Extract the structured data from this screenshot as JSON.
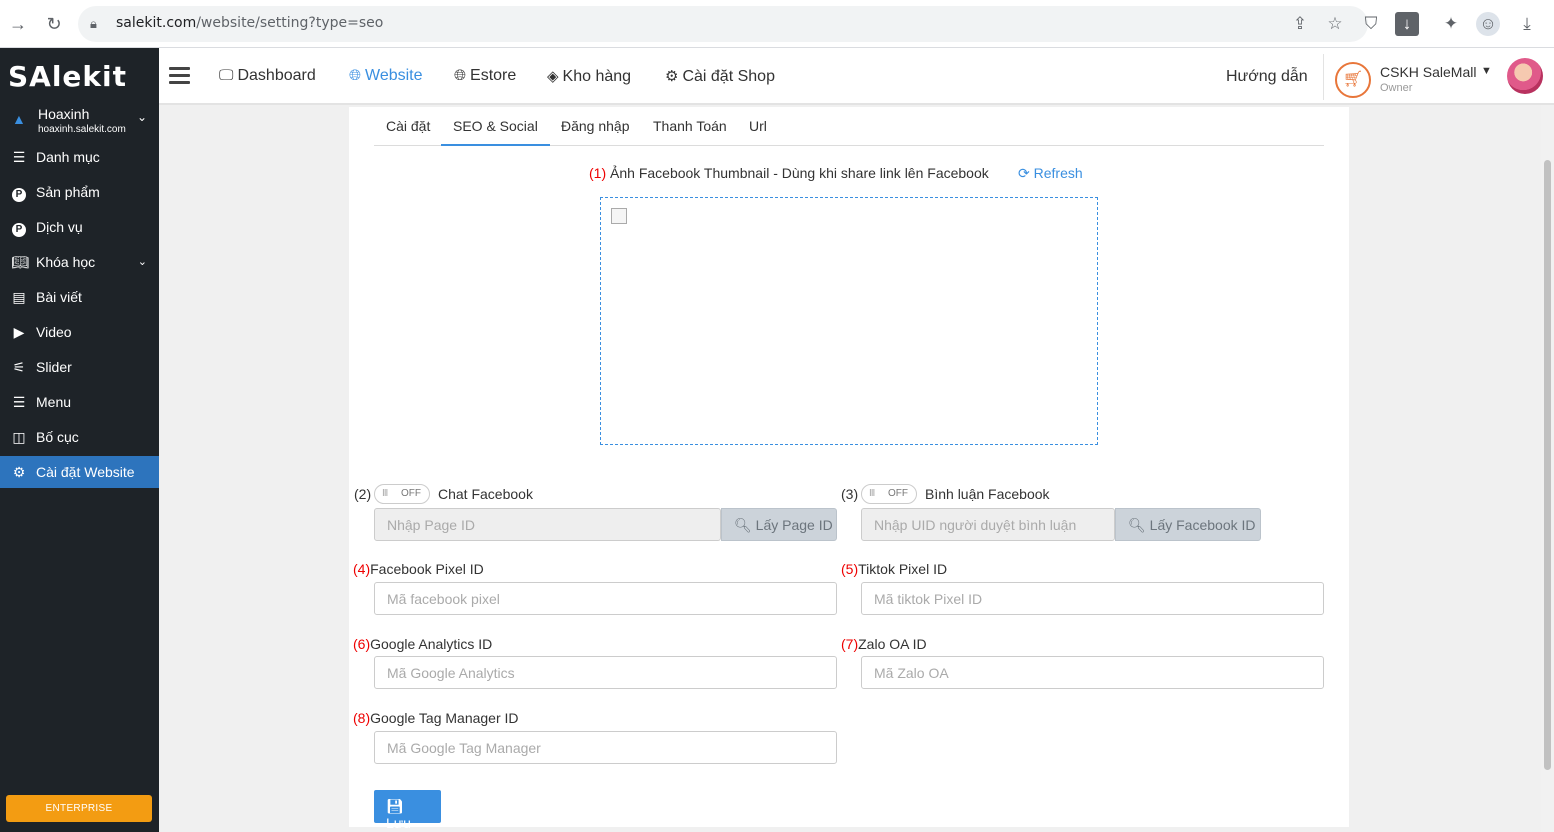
{
  "browser": {
    "url_host": "salekit.com",
    "url_path": "/website/setting?type=seo"
  },
  "sidebar": {
    "logo": "SAlekit",
    "workspace": {
      "name": "Hoaxinh",
      "domain": "hoaxinh.salekit.com"
    },
    "items": [
      {
        "label": "Danh mục"
      },
      {
        "label": "Sản phẩm"
      },
      {
        "label": "Dịch vụ"
      },
      {
        "label": "Khóa học"
      },
      {
        "label": "Bài viết"
      },
      {
        "label": "Video"
      },
      {
        "label": "Slider"
      },
      {
        "label": "Menu"
      },
      {
        "label": "Bố cục"
      },
      {
        "label": "Cài đặt Website"
      }
    ],
    "plan_badge": "ENTERPRISE"
  },
  "header": {
    "nav": [
      {
        "label": "Dashboard"
      },
      {
        "label": "Website"
      },
      {
        "label": "Estore"
      },
      {
        "label": "Kho hàng"
      },
      {
        "label": "Cài đặt Shop"
      }
    ],
    "help": "Hướng dẫn",
    "account_name": "CSKH SaleMall",
    "account_role": "Owner"
  },
  "tabs": [
    "Cài đặt",
    "SEO & Social",
    "Đăng nhập",
    "Thanh Toán",
    "Url"
  ],
  "form": {
    "thumb_num": "(1)",
    "thumb_label": "Ảnh Facebook Thumbnail - Dùng khi share link lên Facebook",
    "refresh": "Refresh",
    "chat": {
      "num": "(2)",
      "toggle": "OFF",
      "label": "Chat Facebook",
      "placeholder": "Nhập Page ID",
      "button": "Lấy Page ID"
    },
    "comment": {
      "num": "(3)",
      "toggle": "OFF",
      "label": "Bình luận Facebook",
      "placeholder": "Nhập UID người duyệt bình luận",
      "button": "Lấy Facebook ID"
    },
    "fb_pixel": {
      "num": "(4)",
      "label": "Facebook Pixel ID",
      "placeholder": "Mã facebook pixel"
    },
    "tiktok_pixel": {
      "num": "(5)",
      "label": "Tiktok Pixel ID",
      "placeholder": "Mã tiktok Pixel ID"
    },
    "ga": {
      "num": "(6)",
      "label": "Google Analytics ID",
      "placeholder": "Mã Google Analytics"
    },
    "zalo": {
      "num": "(7)",
      "label": "Zalo OA ID",
      "placeholder": "Mã Zalo OA"
    },
    "gtm": {
      "num": "(8)",
      "label": "Google Tag Manager ID",
      "placeholder": "Mã Google Tag Manager"
    },
    "save": "Lưu"
  }
}
